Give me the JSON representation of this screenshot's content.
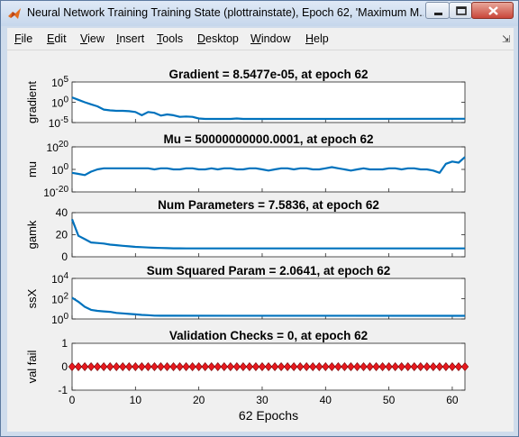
{
  "window": {
    "title": "Neural Network Training Training State (plottrainstate), Epoch 62, 'Maximum M...",
    "min_icon": "minimize-icon",
    "max_icon": "maximize-icon",
    "close_icon": "close-icon",
    "app_icon": "matlab-icon"
  },
  "menu": [
    {
      "label": "File",
      "accel": "F",
      "rest": "ile"
    },
    {
      "label": "Edit",
      "accel": "E",
      "rest": "dit"
    },
    {
      "label": "View",
      "accel": "V",
      "rest": "iew"
    },
    {
      "label": "Insert",
      "accel": "I",
      "rest": "nsert"
    },
    {
      "label": "Tools",
      "accel": "T",
      "rest": "ools"
    },
    {
      "label": "Desktop",
      "accel": "D",
      "rest": "esktop"
    },
    {
      "label": "Window",
      "accel": "W",
      "rest": "indow"
    },
    {
      "label": "Help",
      "accel": "H",
      "rest": "elp"
    }
  ],
  "colors": {
    "line": "#0072bd",
    "marker": "#e8191e",
    "marker_edge": "#7a0c0c"
  },
  "chart_data": [
    {
      "type": "line",
      "title": "Gradient = 8.5477e-05, at epoch 62",
      "ylabel": "gradient",
      "yscale": "log",
      "ylim_exp": [
        -5,
        5
      ],
      "yticks": [
        {
          "base": "10",
          "exp": "5"
        },
        {
          "base": "10",
          "exp": "0"
        },
        {
          "base": "10",
          "exp": "-5"
        }
      ],
      "x": [
        0,
        1,
        2,
        3,
        4,
        5,
        6,
        7,
        8,
        9,
        10,
        11,
        12,
        13,
        14,
        15,
        16,
        17,
        18,
        19,
        20,
        21,
        22,
        23,
        24,
        25,
        26,
        27,
        28,
        29,
        30,
        62
      ],
      "log_values": [
        1.2,
        0.6,
        0,
        -0.5,
        -1,
        -1.8,
        -2,
        -2.1,
        -2.1,
        -2.2,
        -2.4,
        -3.2,
        -2.4,
        -2.6,
        -3.3,
        -3.0,
        -3.2,
        -3.6,
        -3.5,
        -3.6,
        -4.0,
        -4.1,
        -4.1,
        -4.1,
        -4.1,
        -4.1,
        -4.0,
        -4.1,
        -4.1,
        -4.1,
        -4.1,
        -4.07
      ]
    },
    {
      "type": "line",
      "title": "Mu = 50000000000.0001, at epoch 62",
      "ylabel": "mu",
      "yscale": "log",
      "ylim_exp": [
        -20,
        20
      ],
      "yticks": [
        {
          "base": "10",
          "exp": "20"
        },
        {
          "base": "10",
          "exp": "0"
        },
        {
          "base": "10",
          "exp": "-20"
        }
      ],
      "x": [
        0,
        1,
        2,
        3,
        4,
        5,
        6,
        7,
        8,
        9,
        10,
        11,
        12,
        13,
        14,
        15,
        16,
        17,
        18,
        19,
        20,
        21,
        22,
        23,
        24,
        25,
        26,
        27,
        28,
        29,
        30,
        31,
        32,
        33,
        34,
        35,
        36,
        37,
        38,
        39,
        40,
        41,
        42,
        43,
        44,
        45,
        46,
        47,
        48,
        49,
        50,
        51,
        52,
        53,
        54,
        55,
        56,
        57,
        58,
        59,
        60,
        61,
        62
      ],
      "log_values": [
        -3,
        -4,
        -5,
        -2,
        0,
        1,
        1,
        1,
        1,
        1,
        1,
        1,
        1,
        0,
        1,
        1,
        0,
        0,
        1,
        1,
        0,
        0,
        1,
        0,
        1,
        1,
        0,
        0,
        1,
        1,
        0,
        -1,
        0,
        1,
        1,
        0,
        1,
        1,
        0,
        0,
        1,
        2,
        1,
        0,
        -1,
        0,
        1,
        0,
        0,
        0,
        1,
        1,
        0,
        1,
        1,
        0,
        0,
        -1,
        -3,
        5,
        7,
        6,
        11
      ]
    },
    {
      "type": "line",
      "title": "Num Parameters = 7.5836, at epoch 62",
      "ylabel": "gamk",
      "ylim": [
        0,
        40
      ],
      "yticks": [
        "40",
        "20",
        "0"
      ],
      "x": [
        0,
        1,
        2,
        3,
        4,
        5,
        6,
        7,
        8,
        9,
        10,
        11,
        12,
        13,
        14,
        15,
        16,
        17,
        18,
        19,
        20,
        62
      ],
      "values": [
        34,
        19,
        16,
        13,
        12.5,
        12,
        11,
        10.5,
        10,
        9.5,
        9,
        8.7,
        8.4,
        8.2,
        8,
        7.8,
        7.7,
        7.7,
        7.6,
        7.6,
        7.6,
        7.58
      ]
    },
    {
      "type": "line",
      "title": "Sum Squared Param = 2.0641, at epoch 62",
      "ylabel": "ssX",
      "yscale": "log",
      "ylim_exp": [
        0,
        4
      ],
      "yticks": [
        {
          "base": "10",
          "exp": "4"
        },
        {
          "base": "10",
          "exp": "2"
        },
        {
          "base": "10",
          "exp": "0"
        }
      ],
      "x": [
        0,
        1,
        2,
        3,
        4,
        5,
        6,
        7,
        8,
        9,
        10,
        11,
        12,
        13,
        14,
        15,
        62
      ],
      "log_values": [
        2.1,
        1.7,
        1.2,
        0.9,
        0.8,
        0.75,
        0.7,
        0.6,
        0.55,
        0.5,
        0.45,
        0.4,
        0.37,
        0.33,
        0.32,
        0.32,
        0.31
      ]
    },
    {
      "type": "scatter",
      "title": "Validation Checks = 0, at epoch 62",
      "ylabel": "val fail",
      "ylim": [
        -1,
        1
      ],
      "yticks": [
        "1",
        "0",
        "-1"
      ],
      "x_count": 63,
      "value": 0
    }
  ],
  "xaxis": {
    "label": "62 Epochs",
    "ticks": [
      "0",
      "10",
      "20",
      "30",
      "40",
      "50",
      "60"
    ],
    "xlim": [
      0,
      62
    ]
  }
}
